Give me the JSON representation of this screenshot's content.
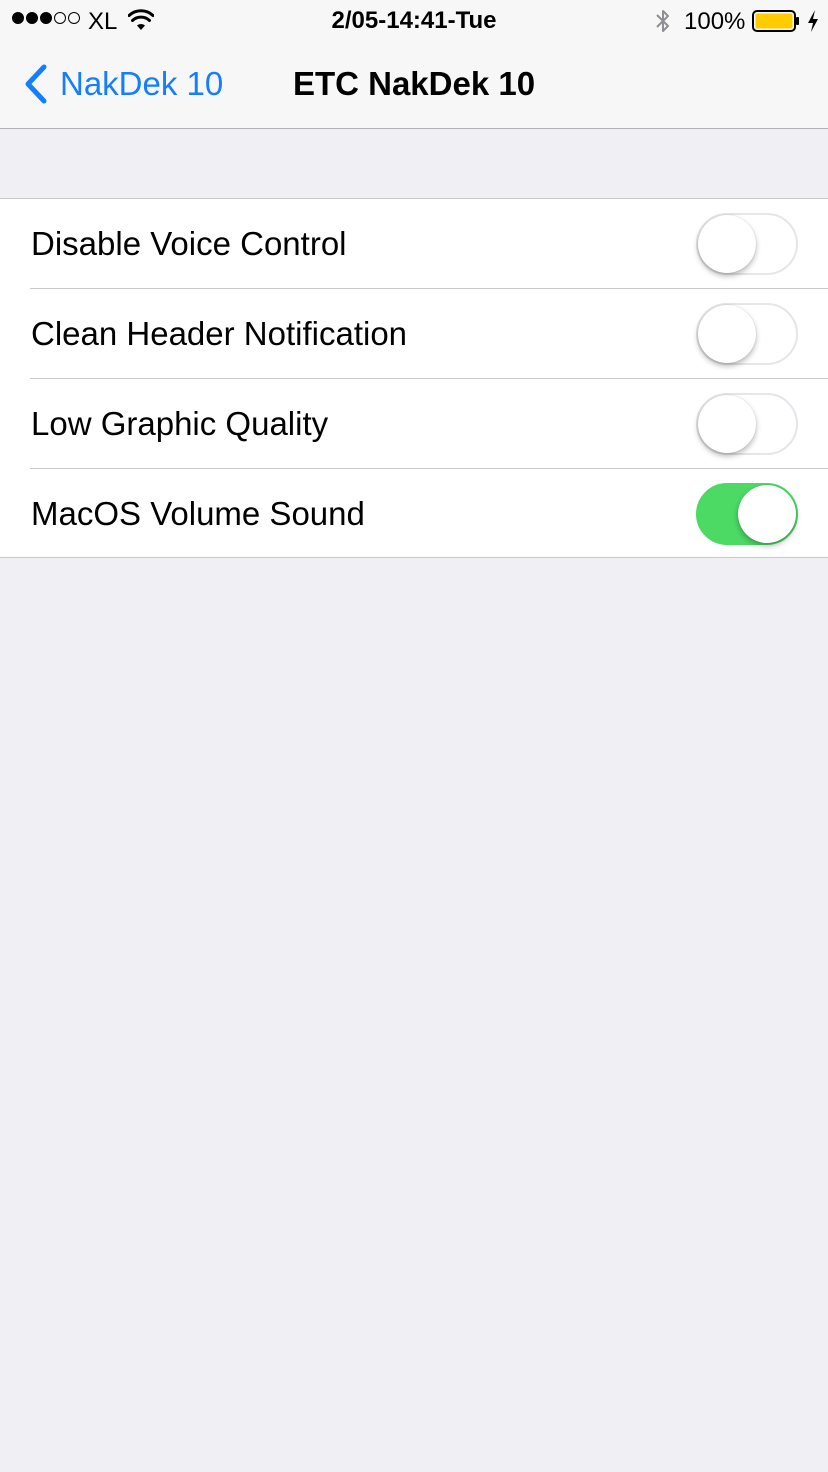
{
  "status_bar": {
    "carrier": "XL",
    "time": "2/05-14:41-Tue",
    "battery_percent": "100%",
    "battery_color": "#ffcc00",
    "signal_bars_filled": 3,
    "signal_bars_total": 5
  },
  "nav": {
    "back_label": "NakDek 10",
    "title": "ETC NakDek 10",
    "accent_color": "#157efb"
  },
  "settings": {
    "on_color": "#4cd964",
    "items": [
      {
        "label": "Disable Voice Control",
        "enabled": false
      },
      {
        "label": "Clean Header Notification",
        "enabled": false
      },
      {
        "label": "Low Graphic Quality",
        "enabled": false
      },
      {
        "label": "MacOS Volume Sound",
        "enabled": true
      }
    ]
  }
}
